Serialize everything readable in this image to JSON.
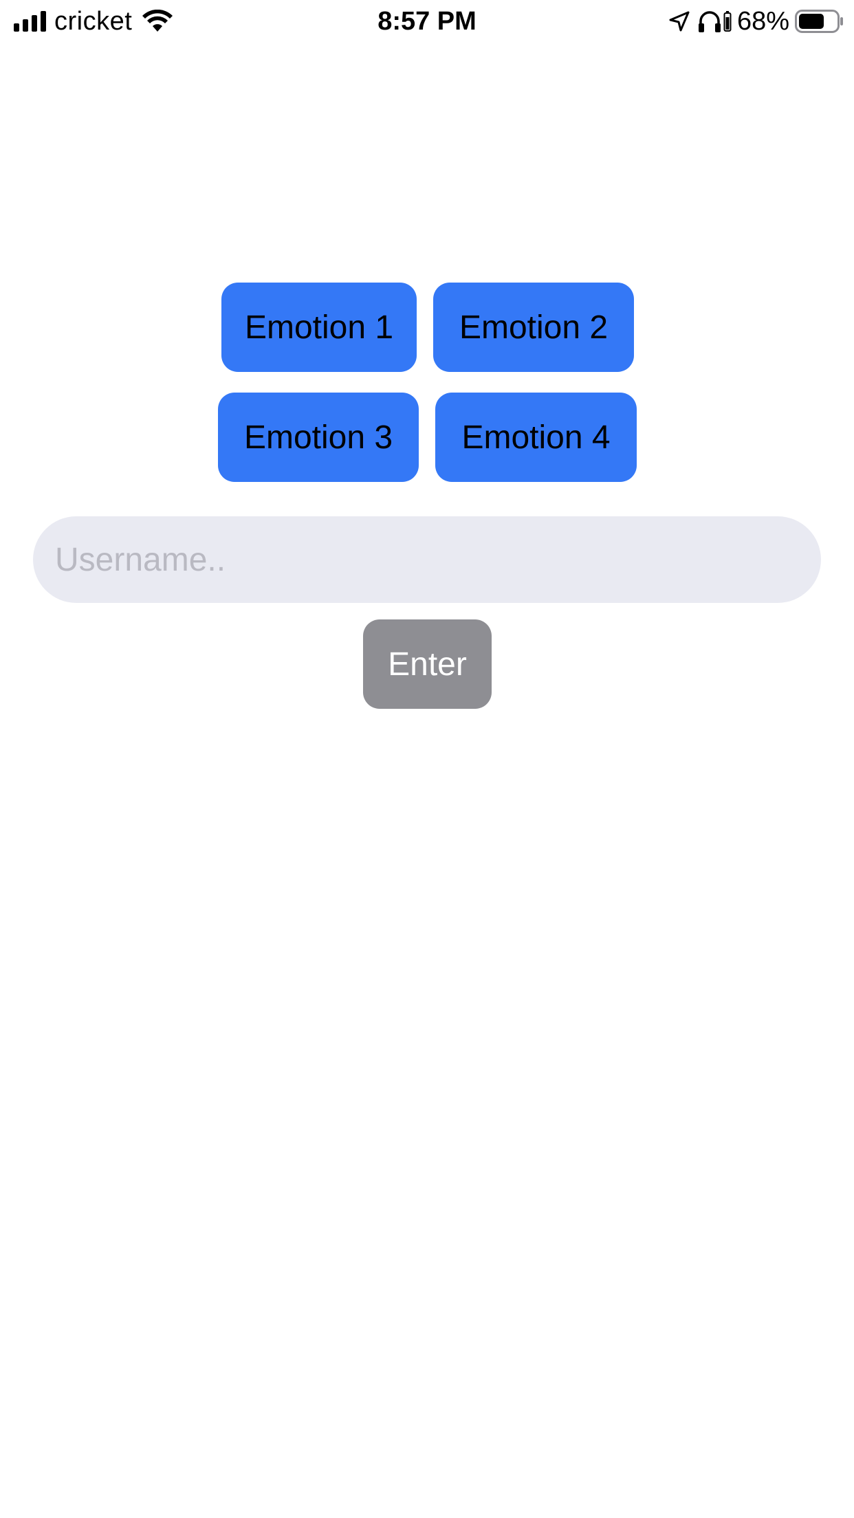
{
  "status_bar": {
    "carrier": "cricket",
    "time": "8:57 PM",
    "battery_percent": "68%",
    "battery_level": 0.68,
    "icons": [
      "signal-bars-icon",
      "wifi-icon",
      "location-arrow-icon",
      "headphones-icon",
      "battery-icon"
    ]
  },
  "emotions": {
    "buttons": [
      {
        "label": "Emotion 1"
      },
      {
        "label": "Emotion 2"
      },
      {
        "label": "Emotion 3"
      },
      {
        "label": "Emotion 4"
      }
    ]
  },
  "username": {
    "value": "",
    "placeholder": "Username.."
  },
  "enter_button": {
    "label": "Enter"
  },
  "colors": {
    "emotion_button_bg": "#3478f6",
    "input_bg": "#e9eaf2",
    "placeholder_text": "#b9b9c2",
    "enter_button_bg": "#8e8e93",
    "background": "#ffffff"
  }
}
